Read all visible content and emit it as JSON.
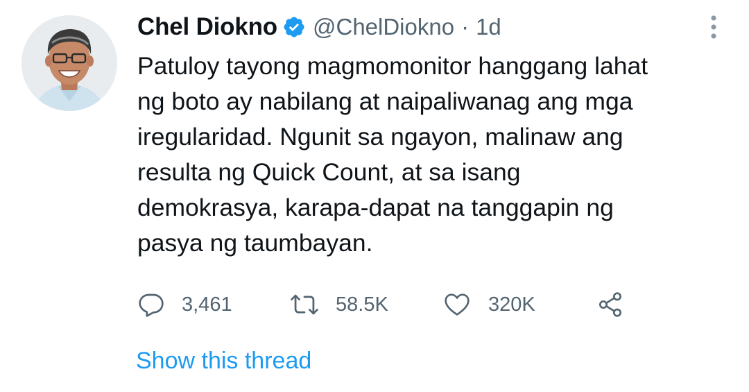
{
  "tweet": {
    "author": {
      "name": "Chel Diokno",
      "handle": "@ChelDiokno",
      "verified": true
    },
    "separator": "·",
    "time": "1d",
    "text_lines": [
      "Patuloy tayong magmomonitor hanggang lahat",
      "ng boto ay nabilang at naipaliwanag ang mga",
      "iregularidad. Ngunit sa ngayon, malinaw ang",
      "resulta ng Quick Count, at sa isang",
      "demokrasya, karapa-dapat na tanggapin ng",
      "pasya ng taumbayan."
    ],
    "actions": {
      "replies": {
        "icon": "reply-icon",
        "count": "3,461"
      },
      "retweets": {
        "icon": "retweet-icon",
        "count": "58.5K"
      },
      "likes": {
        "icon": "heart-icon",
        "count": "320K"
      },
      "share": {
        "icon": "share-icon"
      }
    },
    "show_thread_label": "Show this thread",
    "more_icon": "more-vertical-icon"
  },
  "colors": {
    "text_primary": "#0f1419",
    "text_secondary": "#536471",
    "link": "#1d9bf0",
    "verified_badge": "#1d9bf0",
    "background": "#ffffff"
  }
}
